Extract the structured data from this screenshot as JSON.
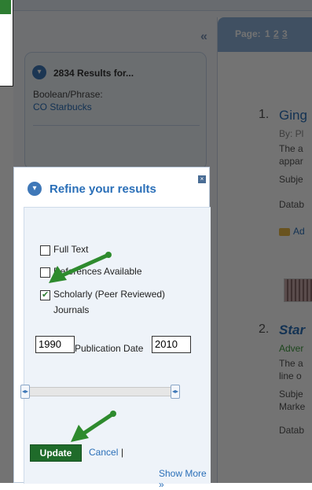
{
  "sidebar": {
    "collapse_icon": "«",
    "results_title": "2834 Results for...",
    "query_label": "Boolean/Phrase:",
    "query_value": "CO Starbucks"
  },
  "pagination": {
    "label": "Page:",
    "pages": [
      "1",
      "2",
      "3"
    ]
  },
  "results": [
    {
      "number": "1.",
      "title": "Ging",
      "byline": "By: Pl",
      "snippet1": "The a",
      "snippet2": "appar",
      "subject": "Subje",
      "database": "Datab",
      "action": "Ad"
    },
    {
      "number": "2.",
      "title": "Star",
      "type": "Adver",
      "snippet1": "The a",
      "snippet2": "line o",
      "subject": "Subje",
      "subject2": "Marke",
      "database": "Datab"
    }
  ],
  "refine": {
    "title": "Refine your results",
    "options": [
      {
        "label": "Full Text",
        "checked": false
      },
      {
        "label": "References Available",
        "checked": false
      },
      {
        "label_line1": "Scholarly (Peer Reviewed)",
        "label_line2": "Journals",
        "checked": true
      }
    ],
    "date_from": "1990",
    "date_label": "Publication Date",
    "date_to": "2010",
    "update_label": "Update",
    "cancel_label": "Cancel",
    "separator": "|",
    "show_more_label": "Show More »"
  },
  "colors": {
    "accent": "#2a6fb8",
    "update_button": "#1f6b2a",
    "arrow": "#2e8b2e"
  }
}
